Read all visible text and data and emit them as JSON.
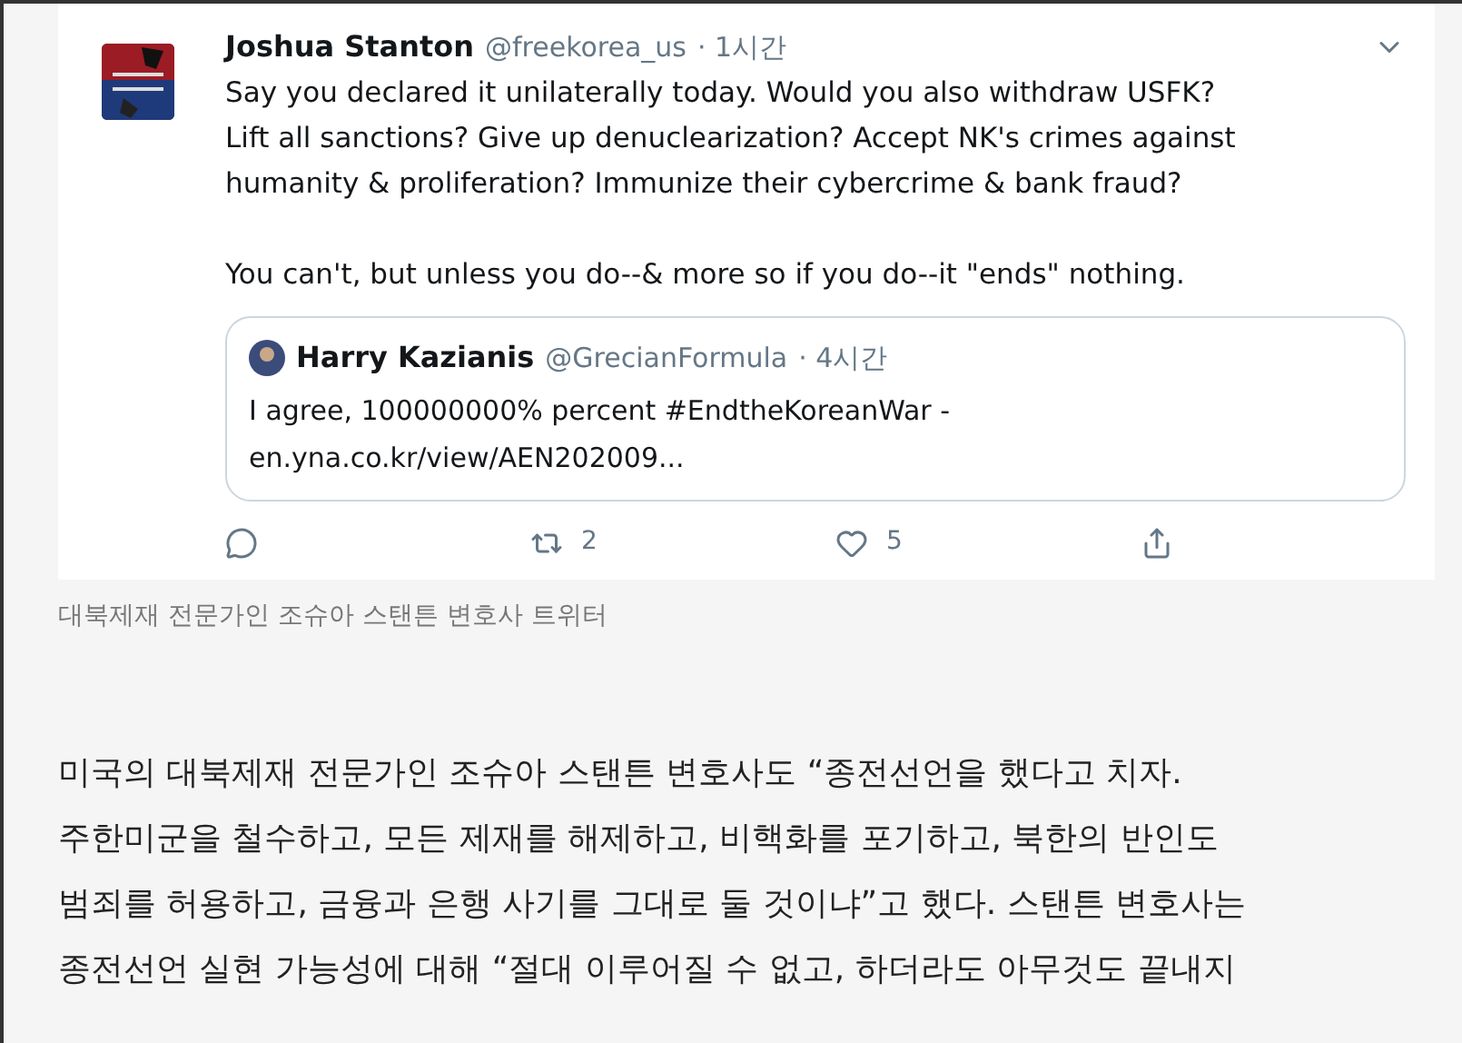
{
  "tweet": {
    "name": "Joshua Stanton",
    "handle": "@freekorea_us",
    "time": "· 1시간",
    "paragraphs": [
      [
        "Say you declared it unilaterally today. Would you also withdraw USFK?",
        "Lift all sanctions? Give up denuclearization? Accept NK's crimes against",
        "humanity & proliferation? Immunize their cybercrime & bank fraud?"
      ],
      [
        "You can't, but unless you do--& more so if you do--it \"ends\" nothing."
      ]
    ],
    "quote": {
      "name": "Harry Kazianis",
      "handle": "@GrecianFormula",
      "time": "· 4시간",
      "lines": [
        "I agree, 100000000% percent #EndtheKoreanWar -",
        "en.yna.co.kr/view/AEN202009..."
      ]
    },
    "actions": [
      {
        "kind": "reply"
      },
      {
        "kind": "retweet",
        "count": "2"
      },
      {
        "kind": "like",
        "count": "5"
      },
      {
        "kind": "share"
      }
    ]
  },
  "caption": "대북제재 전문가인 조슈아 스탠튼 변호사 트위터",
  "article": [
    "미국의 대북제재 전문가인 조슈아 스탠튼 변호사도 “종전선언을 했다고 치자.",
    "주한미군을 철수하고, 모든 제재를 해제하고, 비핵화를 포기하고, 북한의 반인도",
    "범죄를 허용하고, 금융과 은행 사기를 그대로 둘 것이냐”고 했다. 스탠튼 변호사는",
    "종전선언 실현 가능성에 대해 “절대 이루어질 수 없고, 하더라도 아무것도 끝내지"
  ]
}
